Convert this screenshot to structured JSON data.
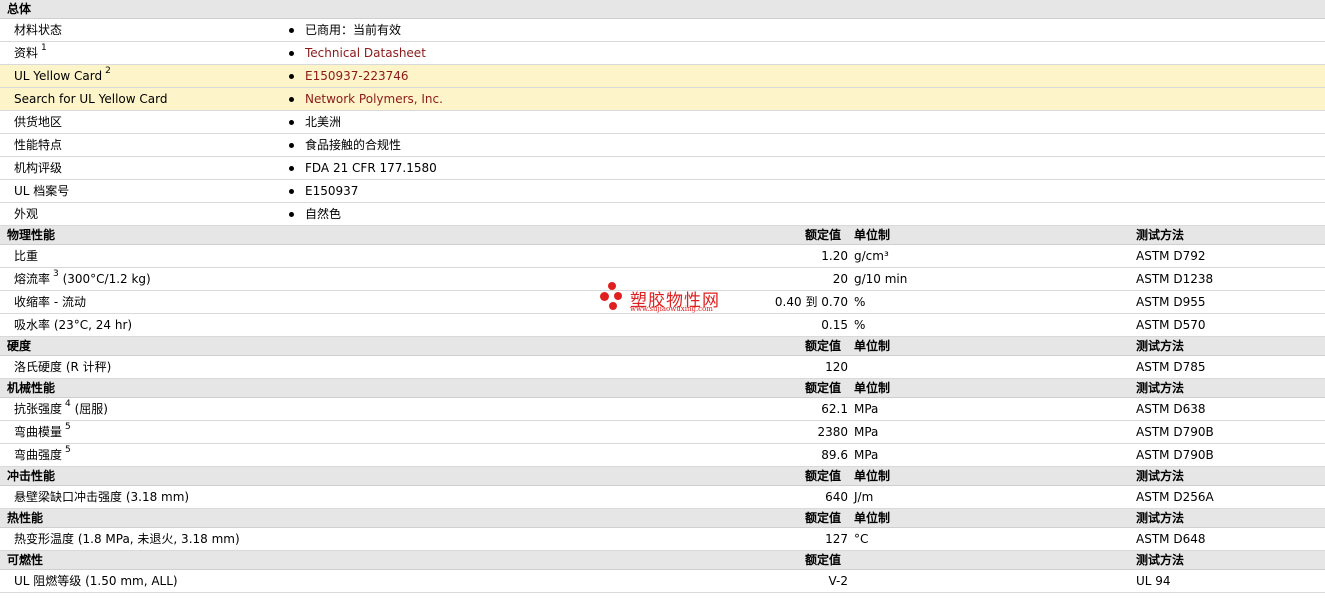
{
  "sections": {
    "general": {
      "title": "总体",
      "rows": [
        {
          "label": "材料状态",
          "sup": "",
          "value": "已商用：当前有效",
          "link": false,
          "hl": false
        },
        {
          "label": "资料",
          "sup": "1",
          "value": "Technical Datasheet",
          "link": true,
          "hl": false
        },
        {
          "label": "UL Yellow Card",
          "sup": "2",
          "value": "E150937-223746",
          "link": true,
          "hl": true
        },
        {
          "label": "Search for UL Yellow Card",
          "sup": "",
          "value": "Network Polymers, Inc.",
          "link": true,
          "hl": true
        },
        {
          "label": "供货地区",
          "sup": "",
          "value": "北美洲",
          "link": false,
          "hl": false
        },
        {
          "label": "性能特点",
          "sup": "",
          "value": "食品接触的合规性",
          "link": false,
          "hl": false
        },
        {
          "label": "机构评级",
          "sup": "",
          "value": "FDA 21 CFR 177.1580",
          "link": false,
          "hl": false
        },
        {
          "label": "UL 档案号",
          "sup": "",
          "value": "E150937",
          "link": false,
          "hl": false
        },
        {
          "label": "外观",
          "sup": "",
          "value": "自然色",
          "link": false,
          "hl": false
        }
      ]
    },
    "physical": {
      "title": "物理性能",
      "col_nominal": "额定值",
      "col_unit": "单位制",
      "col_method": "测试方法",
      "rows": [
        {
          "label": "比重",
          "sup": "",
          "suffix": "",
          "nominal": "1.20",
          "unit": "g/cm³",
          "method": "ASTM D792"
        },
        {
          "label": "熔流率",
          "sup": "3",
          "suffix": "(300°C/1.2 kg)",
          "nominal": "20",
          "unit": "g/10 min",
          "method": "ASTM D1238"
        },
        {
          "label": "收缩率  - 流动",
          "sup": "",
          "suffix": "",
          "nominal": "0.40 到  0.70",
          "unit": "%",
          "method": "ASTM D955"
        },
        {
          "label": "吸水率 (23°C, 24 hr)",
          "sup": "",
          "suffix": "",
          "nominal": "0.15",
          "unit": "%",
          "method": "ASTM D570"
        }
      ]
    },
    "hardness": {
      "title": "硬度",
      "col_nominal": "额定值",
      "col_unit": "单位制",
      "col_method": "测试方法",
      "rows": [
        {
          "label": "洛氏硬度 (R 计秤)",
          "sup": "",
          "suffix": "",
          "nominal": "120",
          "unit": "",
          "method": "ASTM D785"
        }
      ]
    },
    "mechanical": {
      "title": "机械性能",
      "col_nominal": "额定值",
      "col_unit": "单位制",
      "col_method": "测试方法",
      "rows": [
        {
          "label": "抗张强度",
          "sup": "4",
          "suffix": "(屈服)",
          "nominal": "62.1",
          "unit": "MPa",
          "method": "ASTM D638"
        },
        {
          "label": "弯曲模量",
          "sup": "5",
          "suffix": "",
          "nominal": "2380",
          "unit": "MPa",
          "method": "ASTM D790B"
        },
        {
          "label": "弯曲强度",
          "sup": "5",
          "suffix": "",
          "nominal": "89.6",
          "unit": "MPa",
          "method": "ASTM D790B"
        }
      ]
    },
    "impact": {
      "title": "冲击性能",
      "col_nominal": "额定值",
      "col_unit": "单位制",
      "col_method": "测试方法",
      "rows": [
        {
          "label": "悬壁梁缺口冲击强度 (3.18 mm)",
          "sup": "",
          "suffix": "",
          "nominal": "640",
          "unit": "J/m",
          "method": "ASTM D256A"
        }
      ]
    },
    "thermal": {
      "title": "热性能",
      "col_nominal": "额定值",
      "col_unit": "单位制",
      "col_method": "测试方法",
      "rows": [
        {
          "label": "热变形温度 (1.8 MPa, 未退火, 3.18 mm)",
          "sup": "",
          "suffix": "",
          "nominal": "127",
          "unit": "°C",
          "method": "ASTM D648"
        }
      ]
    },
    "flammability": {
      "title": "可燃性",
      "col_nominal": "额定值",
      "col_unit": "",
      "col_method": "测试方法",
      "rows": [
        {
          "label": "UL 阻燃等级 (1.50 mm, ALL)",
          "sup": "",
          "suffix": "",
          "nominal": "V-2",
          "unit": "",
          "method": "UL 94"
        }
      ]
    }
  },
  "watermark": {
    "text": "塑胶物性网",
    "url": "www.sujiaowuxing.com",
    "color": "#e02020"
  },
  "colors": {
    "section_bg": "#e6e6e6",
    "highlight_bg": "#fdf5c9",
    "link": "#8b1a1a"
  }
}
